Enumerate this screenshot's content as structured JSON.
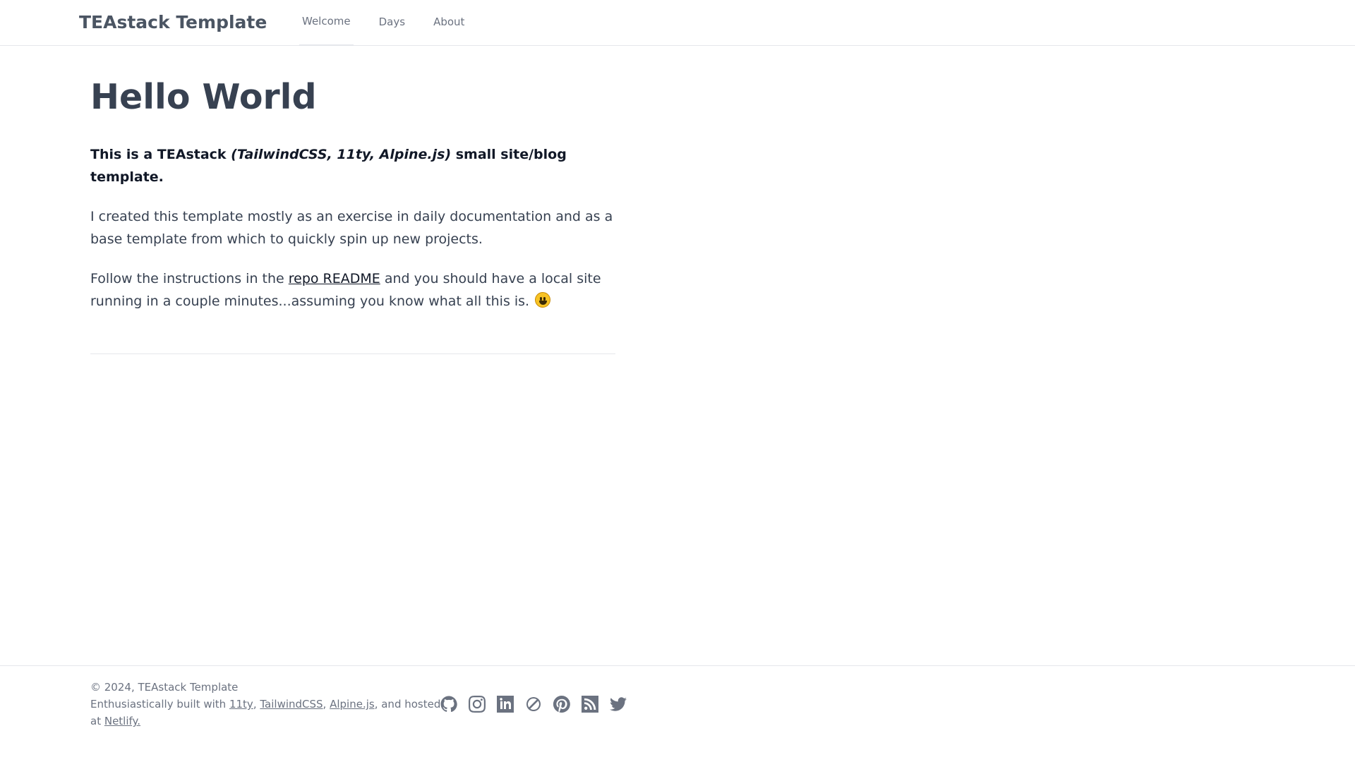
{
  "header": {
    "brand": "TEAstack Template",
    "nav": [
      {
        "label": "Welcome",
        "active": true
      },
      {
        "label": "Days",
        "active": false
      },
      {
        "label": "About",
        "active": false
      }
    ]
  },
  "main": {
    "title": "Hello World",
    "lead": {
      "prefix": "This is a TEAstack ",
      "emphasis": "(TailwindCSS, 11ty, Alpine.js)",
      "suffix": " small site/blog template."
    },
    "para1": "I created this template mostly as an exercise in daily documentation and as a base template from which to quickly spin up new projects.",
    "para2": {
      "before": "Follow the instructions in the ",
      "link": "repo README",
      "after": " and you should have a local site running in a couple minutes...assuming you know what all this is."
    }
  },
  "footer": {
    "copyright": "© 2024, TEAstack Template",
    "built_prefix": "Enthusiastically built with ",
    "links": [
      "11ty",
      "TailwindCSS",
      "Alpine.js"
    ],
    "hosted_text": ", and hosted at ",
    "host_link": "Netlify.",
    "social_icons": [
      "github-icon",
      "instagram-icon",
      "linkedin-icon",
      "codepen-icon",
      "pinterest-icon",
      "rss-icon",
      "twitter-icon"
    ],
    "icon_color": "#6b7280"
  }
}
